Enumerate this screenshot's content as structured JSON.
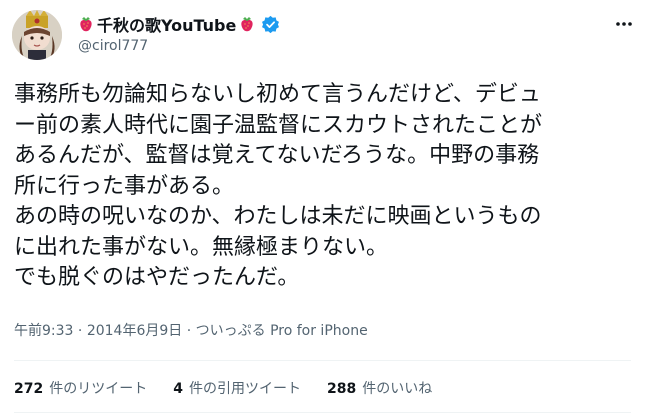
{
  "author": {
    "display_name": "千秋の歌YouTube",
    "handle": "@cirol777",
    "verified": true,
    "name_emoji": "strawberry"
  },
  "tweet": {
    "lines": [
      "事務所も勿論知らないし初めて言うんだけど、デビュ",
      "ー前の素人時代に園子温監督にスカウトされたことが",
      "あるんだが、監督は覚えてないだろうな。中野の事務",
      "所に行った事がある。",
      "あの時の呪いなのか、わたしは未だに映画というもの",
      "に出れた事がない。無縁極まりない。",
      "でも脱ぐのはやだったんだ。"
    ],
    "time": "午前9:33",
    "date": "2014年6月9日",
    "source": "ついっぷる Pro for iPhone",
    "separator": "·"
  },
  "stats": {
    "retweets_count": "272",
    "retweets_label": "件のリツイート",
    "quotes_count": "4",
    "quotes_label": "件の引用ツイート",
    "likes_count": "288",
    "likes_label": "件のいいね"
  },
  "colors": {
    "text": "#0f1419",
    "secondary": "#536471",
    "verified": "#1d9bf0"
  },
  "icons": {
    "more": "more-horizontal-icon",
    "verified": "verified-badge-icon",
    "strawberry": "strawberry-icon"
  }
}
